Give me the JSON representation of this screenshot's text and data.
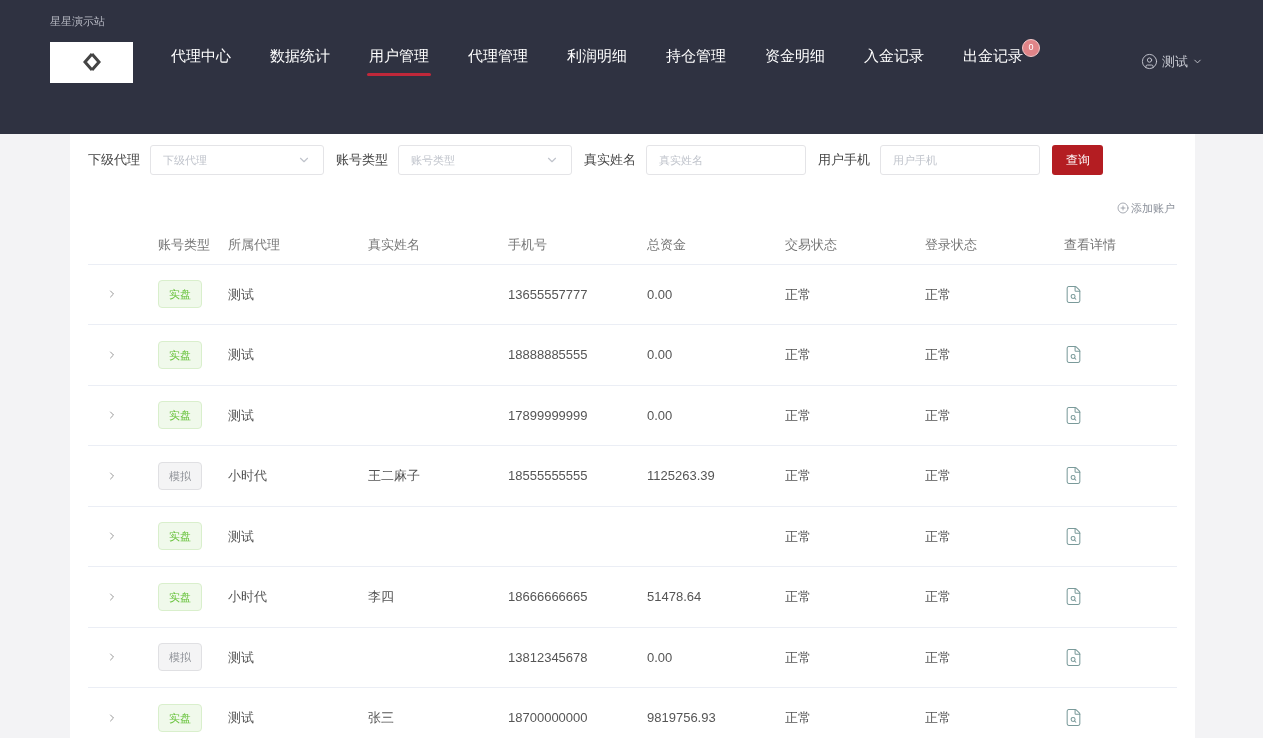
{
  "site_name": "星星演示站",
  "nav": [
    {
      "label": "代理中心",
      "selected": false
    },
    {
      "label": "数据统计",
      "selected": false
    },
    {
      "label": "用户管理",
      "selected": true
    },
    {
      "label": "代理管理",
      "selected": false
    },
    {
      "label": "利润明细",
      "selected": false
    },
    {
      "label": "持仓管理",
      "selected": false
    },
    {
      "label": "资金明细",
      "selected": false
    },
    {
      "label": "入金记录",
      "selected": false
    },
    {
      "label": "出金记录",
      "selected": false,
      "badge": "0"
    }
  ],
  "user": {
    "name": "测试"
  },
  "filters": [
    {
      "label": "下级代理",
      "placeholder": "下级代理",
      "kind": "select"
    },
    {
      "label": "账号类型",
      "placeholder": "账号类型",
      "kind": "select"
    },
    {
      "label": "真实姓名",
      "placeholder": "真实姓名",
      "kind": "input"
    },
    {
      "label": "用户手机",
      "placeholder": "用户手机",
      "kind": "input"
    }
  ],
  "query_button": "查询",
  "add_account": "添加账户",
  "table": {
    "columns": [
      "账号类型",
      "所属代理",
      "真实姓名",
      "手机号",
      "总资金",
      "交易状态",
      "登录状态",
      "查看详情"
    ],
    "rows": [
      {
        "type": "实盘",
        "kind": "real",
        "agent": "测试",
        "name": "",
        "phone": "13655557777",
        "funds": "0.00",
        "trade": "正常",
        "login": "正常"
      },
      {
        "type": "实盘",
        "kind": "real",
        "agent": "测试",
        "name": "",
        "phone": "18888885555",
        "funds": "0.00",
        "trade": "正常",
        "login": "正常"
      },
      {
        "type": "实盘",
        "kind": "real",
        "agent": "测试",
        "name": "",
        "phone": "17899999999",
        "funds": "0.00",
        "trade": "正常",
        "login": "正常"
      },
      {
        "type": "模拟",
        "kind": "demo",
        "agent": "小时代",
        "name": "王二麻子",
        "phone": "18555555555",
        "funds": "1125263.39",
        "trade": "正常",
        "login": "正常"
      },
      {
        "type": "实盘",
        "kind": "real",
        "agent": "测试",
        "name": "",
        "phone": "",
        "funds": "",
        "trade": "正常",
        "login": "正常"
      },
      {
        "type": "实盘",
        "kind": "real",
        "agent": "小时代",
        "name": "李四",
        "phone": "18666666665",
        "funds": "51478.64",
        "trade": "正常",
        "login": "正常"
      },
      {
        "type": "模拟",
        "kind": "demo",
        "agent": "测试",
        "name": "",
        "phone": "13812345678",
        "funds": "0.00",
        "trade": "正常",
        "login": "正常"
      },
      {
        "type": "实盘",
        "kind": "real",
        "agent": "测试",
        "name": "张三",
        "phone": "18700000000",
        "funds": "9819756.93",
        "trade": "正常",
        "login": "正常"
      }
    ]
  }
}
